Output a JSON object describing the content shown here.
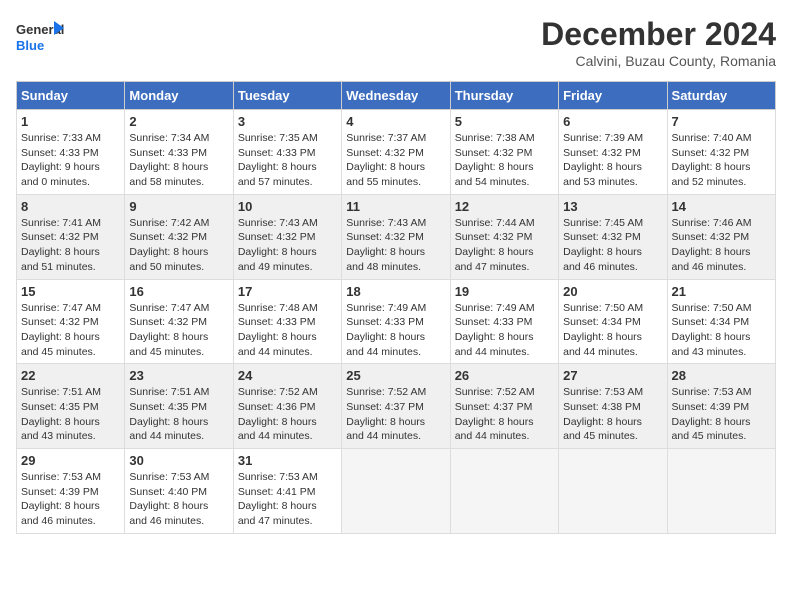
{
  "logo": {
    "line1": "General",
    "line2": "Blue"
  },
  "title": "December 2024",
  "subtitle": "Calvini, Buzau County, Romania",
  "weekdays": [
    "Sunday",
    "Monday",
    "Tuesday",
    "Wednesday",
    "Thursday",
    "Friday",
    "Saturday"
  ],
  "weeks": [
    [
      {
        "day": "1",
        "info": "Sunrise: 7:33 AM\nSunset: 4:33 PM\nDaylight: 9 hours\nand 0 minutes."
      },
      {
        "day": "2",
        "info": "Sunrise: 7:34 AM\nSunset: 4:33 PM\nDaylight: 8 hours\nand 58 minutes."
      },
      {
        "day": "3",
        "info": "Sunrise: 7:35 AM\nSunset: 4:33 PM\nDaylight: 8 hours\nand 57 minutes."
      },
      {
        "day": "4",
        "info": "Sunrise: 7:37 AM\nSunset: 4:32 PM\nDaylight: 8 hours\nand 55 minutes."
      },
      {
        "day": "5",
        "info": "Sunrise: 7:38 AM\nSunset: 4:32 PM\nDaylight: 8 hours\nand 54 minutes."
      },
      {
        "day": "6",
        "info": "Sunrise: 7:39 AM\nSunset: 4:32 PM\nDaylight: 8 hours\nand 53 minutes."
      },
      {
        "day": "7",
        "info": "Sunrise: 7:40 AM\nSunset: 4:32 PM\nDaylight: 8 hours\nand 52 minutes."
      }
    ],
    [
      {
        "day": "8",
        "info": "Sunrise: 7:41 AM\nSunset: 4:32 PM\nDaylight: 8 hours\nand 51 minutes."
      },
      {
        "day": "9",
        "info": "Sunrise: 7:42 AM\nSunset: 4:32 PM\nDaylight: 8 hours\nand 50 minutes."
      },
      {
        "day": "10",
        "info": "Sunrise: 7:43 AM\nSunset: 4:32 PM\nDaylight: 8 hours\nand 49 minutes."
      },
      {
        "day": "11",
        "info": "Sunrise: 7:43 AM\nSunset: 4:32 PM\nDaylight: 8 hours\nand 48 minutes."
      },
      {
        "day": "12",
        "info": "Sunrise: 7:44 AM\nSunset: 4:32 PM\nDaylight: 8 hours\nand 47 minutes."
      },
      {
        "day": "13",
        "info": "Sunrise: 7:45 AM\nSunset: 4:32 PM\nDaylight: 8 hours\nand 46 minutes."
      },
      {
        "day": "14",
        "info": "Sunrise: 7:46 AM\nSunset: 4:32 PM\nDaylight: 8 hours\nand 46 minutes."
      }
    ],
    [
      {
        "day": "15",
        "info": "Sunrise: 7:47 AM\nSunset: 4:32 PM\nDaylight: 8 hours\nand 45 minutes."
      },
      {
        "day": "16",
        "info": "Sunrise: 7:47 AM\nSunset: 4:32 PM\nDaylight: 8 hours\nand 45 minutes."
      },
      {
        "day": "17",
        "info": "Sunrise: 7:48 AM\nSunset: 4:33 PM\nDaylight: 8 hours\nand 44 minutes."
      },
      {
        "day": "18",
        "info": "Sunrise: 7:49 AM\nSunset: 4:33 PM\nDaylight: 8 hours\nand 44 minutes."
      },
      {
        "day": "19",
        "info": "Sunrise: 7:49 AM\nSunset: 4:33 PM\nDaylight: 8 hours\nand 44 minutes."
      },
      {
        "day": "20",
        "info": "Sunrise: 7:50 AM\nSunset: 4:34 PM\nDaylight: 8 hours\nand 44 minutes."
      },
      {
        "day": "21",
        "info": "Sunrise: 7:50 AM\nSunset: 4:34 PM\nDaylight: 8 hours\nand 43 minutes."
      }
    ],
    [
      {
        "day": "22",
        "info": "Sunrise: 7:51 AM\nSunset: 4:35 PM\nDaylight: 8 hours\nand 43 minutes."
      },
      {
        "day": "23",
        "info": "Sunrise: 7:51 AM\nSunset: 4:35 PM\nDaylight: 8 hours\nand 44 minutes."
      },
      {
        "day": "24",
        "info": "Sunrise: 7:52 AM\nSunset: 4:36 PM\nDaylight: 8 hours\nand 44 minutes."
      },
      {
        "day": "25",
        "info": "Sunrise: 7:52 AM\nSunset: 4:37 PM\nDaylight: 8 hours\nand 44 minutes."
      },
      {
        "day": "26",
        "info": "Sunrise: 7:52 AM\nSunset: 4:37 PM\nDaylight: 8 hours\nand 44 minutes."
      },
      {
        "day": "27",
        "info": "Sunrise: 7:53 AM\nSunset: 4:38 PM\nDaylight: 8 hours\nand 45 minutes."
      },
      {
        "day": "28",
        "info": "Sunrise: 7:53 AM\nSunset: 4:39 PM\nDaylight: 8 hours\nand 45 minutes."
      }
    ],
    [
      {
        "day": "29",
        "info": "Sunrise: 7:53 AM\nSunset: 4:39 PM\nDaylight: 8 hours\nand 46 minutes."
      },
      {
        "day": "30",
        "info": "Sunrise: 7:53 AM\nSunset: 4:40 PM\nDaylight: 8 hours\nand 46 minutes."
      },
      {
        "day": "31",
        "info": "Sunrise: 7:53 AM\nSunset: 4:41 PM\nDaylight: 8 hours\nand 47 minutes."
      },
      null,
      null,
      null,
      null
    ]
  ]
}
